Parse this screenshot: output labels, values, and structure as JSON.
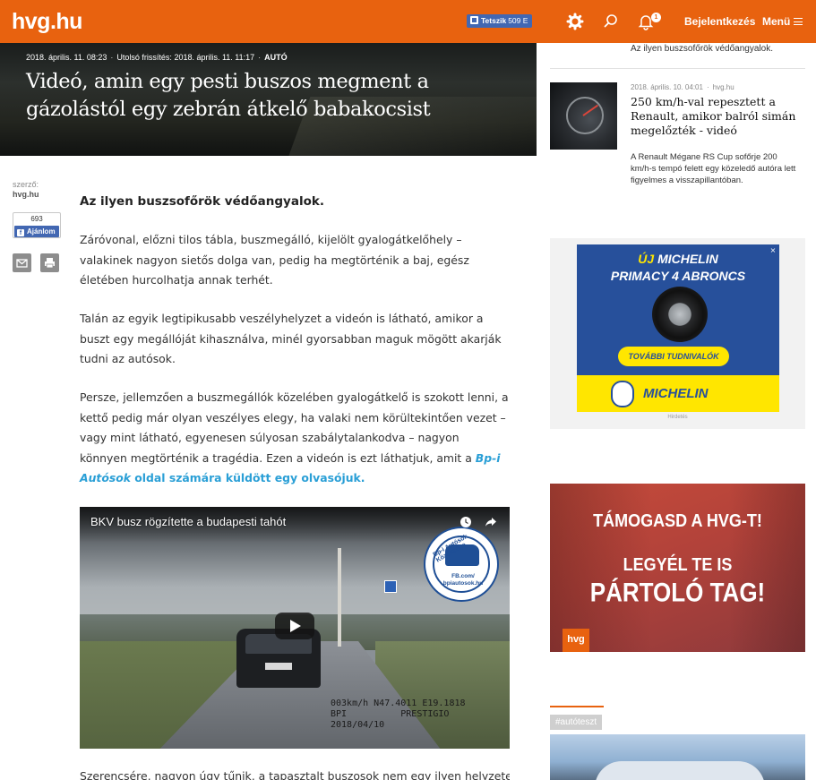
{
  "header": {
    "logo": "hvg.hu",
    "fb_like_label": "Tetszik",
    "fb_like_count": "509 E",
    "notification_count": "1",
    "login_label": "Bejelentkezés",
    "menu_label": "Menü",
    "accent_color": "#e8620f"
  },
  "article": {
    "published": "2018. április. 11. 08:23",
    "updated_label": "Utolsó frissítés:",
    "updated": "2018. április. 11. 11:17",
    "category": "AUTÓ",
    "title": "Videó, amin egy pesti buszos megment a gázolástól egy zebrán átkelő babakocsist",
    "author_label": "szerző:",
    "author": "hvg.hu",
    "share_count": "693",
    "share_label": "Ajánlom",
    "lead": "Az ilyen buszsofőrök védőangyalok.",
    "p1": "Záróvonal, előzni tilos tábla, buszmegálló, kijelölt gyalogátkelőhely – valakinek nagyon sietős dolga van, pedig ha megtörténik a baj, egész életében hurcolhatja annak terhét.",
    "p2": "Talán az egyik legtipikusabb veszélyhelyzet a videón is látható, amikor a buszt egy megállóját kihasználva, minél gyorsabban maguk mögött akarják tudni az autósok.",
    "p3_text": "Persze, jellemzően a buszmegállók közelében gyalogátkelő is szokott lenni, a kettő pedig már olyan veszélyes elegy, ha valaki nem körültekintően vezet – vagy mint látható, egyenesen súlyosan szabálytalankodva – nagyon könnyen megtörténik a tragédia. Ezen a videón is ezt láthatjuk, amit a ",
    "p3_link_italic": "Bp-i Autósok",
    "p3_link_rest": " oldal számára küldött egy olvasójuk.",
    "video_title": "BKV busz rögzítette a budapesti tahót",
    "video_osd": "003km/h N47.4011 E19.1818\nBPI          PRESTIGIO\n2018/04/10",
    "video_badge_ring": "Bp-i Autósok Közössége",
    "video_badge_url": "FB.com/\nbpiautosok.hu",
    "p4_cut": "Szerencsére, nagyon úgy tűnik, a tapasztalt buszosok nem egy ilyen helyzetet"
  },
  "sidebar": {
    "top_text": "Az ilyen buszsofőrök védőangyalok.",
    "item": {
      "date": "2018. április. 10. 04:01",
      "source": "hvg.hu",
      "title": "250 km/h-val repesztett a Renault, amikor balról simán megelőzték - videó",
      "desc": "A Renault Mégane RS Cup sofőrje 200 km/h-s tempó felett egy közeledő autóra lett figyelmes a visszapillantóban."
    },
    "ad": {
      "line1_prefix": "ÚJ",
      "line1": "MICHELIN",
      "line2": "PRIMACY 4 ABRONCS",
      "cta": "TOVÁBBI TUDNIVALÓK",
      "brand": "MICHELIN",
      "label": "Hirdetés",
      "close": "×"
    },
    "promo": {
      "line1": "TÁMOGASD A HVG-T!",
      "line2": "LEGYÉL TE IS",
      "line3": "PÁRTOLÓ TAG!",
      "logo": "hvg"
    },
    "tag": "#autóteszt"
  }
}
